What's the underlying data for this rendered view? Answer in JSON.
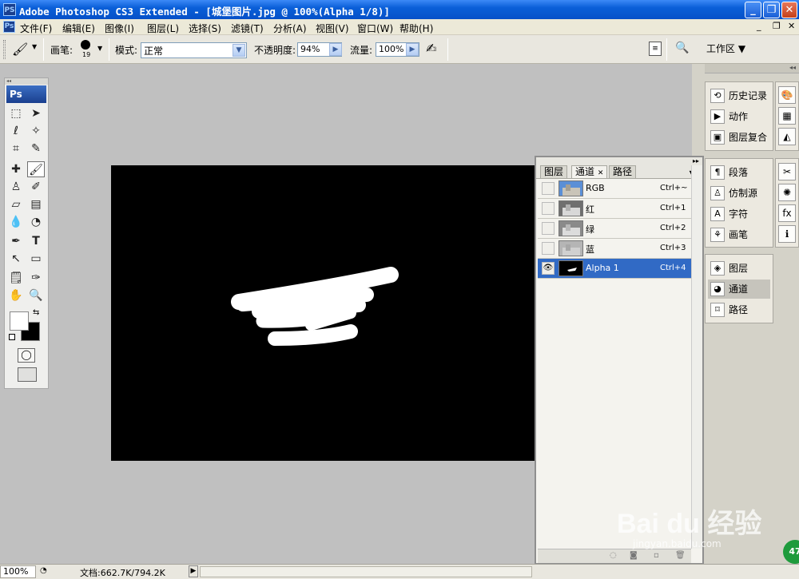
{
  "titlebar": {
    "app_icon": "PS",
    "title": "Adobe Photoshop CS3 Extended - [城堡图片.jpg @ 100%(Alpha 1/8)]"
  },
  "menu": {
    "items": [
      "文件(F)",
      "编辑(E)",
      "图像(I)",
      "图层(L)",
      "选择(S)",
      "滤镜(T)",
      "分析(A)",
      "视图(V)",
      "窗口(W)",
      "帮助(H)"
    ]
  },
  "options": {
    "brush_label": "画笔:",
    "brush_size": "19",
    "mode_label": "模式:",
    "mode_value": "正常",
    "opacity_label": "不透明度:",
    "opacity_value": "94%",
    "flow_label": "流量:",
    "flow_value": "100%",
    "workspace_label": "工作区 ▼"
  },
  "tools_panel": {
    "logo": "Ps"
  },
  "status": {
    "zoom": "100%",
    "doc_info": "文档:662.7K/794.2K"
  },
  "dock": {
    "group1": [
      "历史记录",
      "动作",
      "图层复合"
    ],
    "group2": [
      "段落",
      "仿制源",
      "字符",
      "画笔"
    ],
    "group3": [
      "图层",
      "通道",
      "路径"
    ]
  },
  "channels_panel": {
    "tabs": [
      "图层",
      "通道",
      "路径"
    ],
    "rows": [
      {
        "name": "RGB",
        "shortcut": "Ctrl+~"
      },
      {
        "name": "红",
        "shortcut": "Ctrl+1"
      },
      {
        "name": "绿",
        "shortcut": "Ctrl+2"
      },
      {
        "name": "蓝",
        "shortcut": "Ctrl+3"
      },
      {
        "name": "Alpha 1",
        "shortcut": "Ctrl+4"
      }
    ]
  },
  "watermark": {
    "brand": "Bai du 经验",
    "url": "jingyan.baidu.com"
  },
  "colors": {
    "titlebar": "#0a5fd8",
    "selection": "#316ac5",
    "canvas": "#000000",
    "workspace_bg": "#c0c0c0"
  }
}
